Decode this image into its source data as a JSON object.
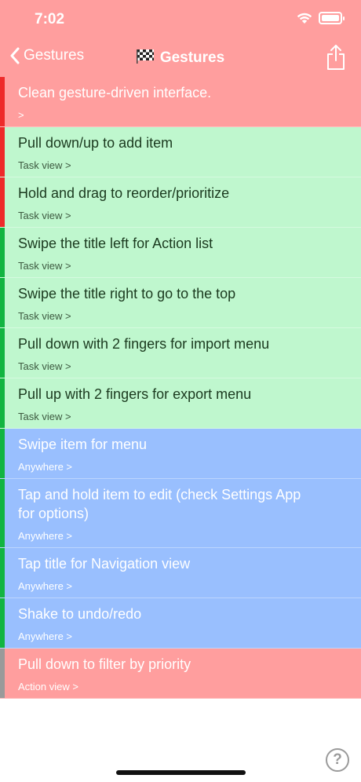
{
  "status": {
    "time": "7:02"
  },
  "nav": {
    "back_label": "Gestures",
    "title": "Gestures"
  },
  "colors": {
    "red": "#ff9e9e",
    "green": "#bff7ce",
    "blue": "#99bffe",
    "strip_red": "#ee2a2a",
    "strip_green": "#12b541",
    "strip_grey": "#9a9a9a"
  },
  "items": [
    {
      "title": "Clean gesture-driven interface.",
      "subtitle": ">"
    },
    {
      "title": "Pull down/up to add item",
      "subtitle": "Task view >"
    },
    {
      "title": "Hold and drag to reorder/prioritize",
      "subtitle": "Task view >"
    },
    {
      "title": "Swipe the title left for Action list",
      "subtitle": "Task view >"
    },
    {
      "title": "Swipe the title right to go to the top",
      "subtitle": "Task view >"
    },
    {
      "title": "Pull down with 2 fingers for import menu",
      "subtitle": "Task view >"
    },
    {
      "title": "Pull up with 2 fingers for export menu",
      "subtitle": "Task view >"
    },
    {
      "title": "Swipe item for menu",
      "subtitle": "Anywhere >"
    },
    {
      "title": "Tap and hold item to edit (check Settings App",
      "title2": "for options)",
      "subtitle": "Anywhere >"
    },
    {
      "title": "Tap title for Navigation view",
      "subtitle": "Anywhere >"
    },
    {
      "title": "Shake to undo/redo",
      "subtitle": "Anywhere >"
    },
    {
      "title": "Pull down to filter by priority",
      "subtitle": "Action view >"
    }
  ],
  "help": {
    "label": "?"
  }
}
